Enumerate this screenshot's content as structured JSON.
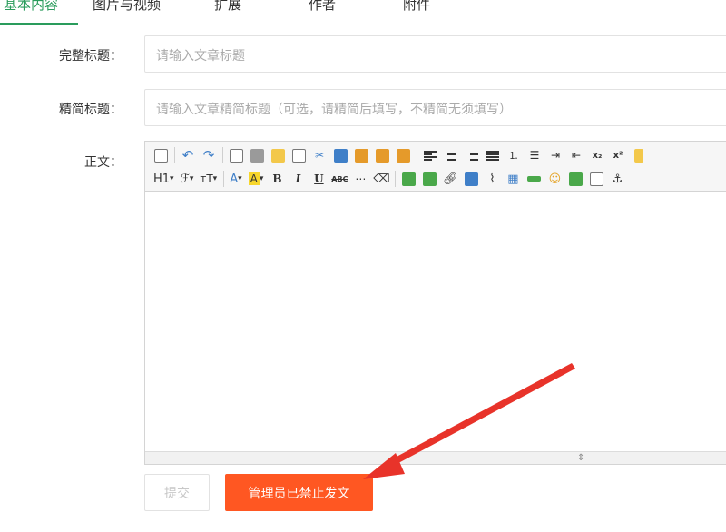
{
  "tabs": [
    {
      "label": "基本内容",
      "active": true
    },
    {
      "label": "图片与视频",
      "active": false
    },
    {
      "label": "扩展",
      "active": false
    },
    {
      "label": "作者",
      "active": false
    },
    {
      "label": "附件",
      "active": false
    }
  ],
  "form": {
    "full_title_label": "完整标题：",
    "full_title_placeholder": "请输入文章标题",
    "short_title_label": "精简标题：",
    "short_title_placeholder": "请输入文章精简标题（可选，请精简后填写，不精简无须填写）",
    "body_label": "正文："
  },
  "toolbar": {
    "heading": "H1",
    "font_family": "ℱ",
    "font_size": "ᴛT",
    "font_color": "A",
    "bg_color": "A",
    "bold": "B",
    "italic": "I",
    "underline": "U",
    "strike": "ABC",
    "subscript": "x₂",
    "superscript": "x²",
    "dropdown_caret": "▾"
  },
  "buttons": {
    "submit_label": "提交",
    "banned_label": "管理员已禁止发文"
  },
  "colors": {
    "accent": "#2a9c5c",
    "danger": "#ff5722",
    "arrow": "#e8332a"
  }
}
